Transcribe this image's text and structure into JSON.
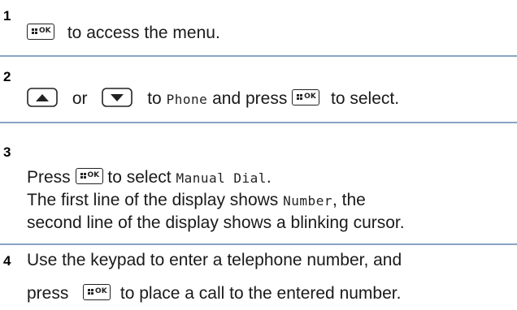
{
  "steps": [
    {
      "number": "1",
      "line1_text": "to access the menu."
    },
    {
      "number": "2",
      "or_text": "or",
      "to_text": "to",
      "menu_item": "Phone",
      "and_press": "and press",
      "to_select": "to select."
    },
    {
      "number": "3",
      "press": "Press",
      "to_select": "to select",
      "menu_item": "Manual Dial",
      "period": ".",
      "line2_pre": "The first line of the display shows",
      "display_text": "Number",
      "line2_post": ", the",
      "line3": "second line of the display shows a blinking cursor."
    },
    {
      "number": "4",
      "line1": "Use the keypad to enter a telephone number, and",
      "press": "press",
      "line2_post": "to place a call to the entered number."
    }
  ],
  "keys": {
    "ok_label": "OK"
  },
  "icons": {
    "ok_key": "menu-ok-button-icon",
    "up_key": "up-arrow-button-icon",
    "down_key": "down-arrow-button-icon"
  },
  "colors": {
    "divider": "#8aa3c4",
    "text": "#1a1a1a"
  }
}
